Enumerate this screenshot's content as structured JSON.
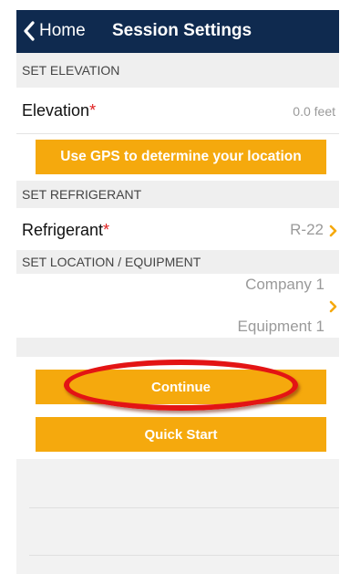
{
  "nav": {
    "back_label": "Home",
    "title": "Session Settings"
  },
  "sections": {
    "elevation_header": "SET ELEVATION",
    "refrigerant_header": "SET REFRIGERANT",
    "location_header": "SET LOCATION / EQUIPMENT"
  },
  "elevation": {
    "label": "Elevation",
    "required_mark": "*",
    "value": "0.0 feet"
  },
  "gps_button": "Use GPS to determine your location",
  "refrigerant": {
    "label": "Refrigerant",
    "required_mark": "*",
    "value": "R-22"
  },
  "location": {
    "company": "Company 1",
    "equipment": "Equipment 1"
  },
  "buttons": {
    "continue": "Continue",
    "quick_start": "Quick Start"
  },
  "colors": {
    "nav_background": "#0f2a4f",
    "accent_orange": "#f5a90d",
    "required_red": "#e02020",
    "highlight_ellipse": "#e31414"
  },
  "icons": {
    "back": "chevron-left-icon",
    "disclosure": "chevron-right-icon"
  }
}
